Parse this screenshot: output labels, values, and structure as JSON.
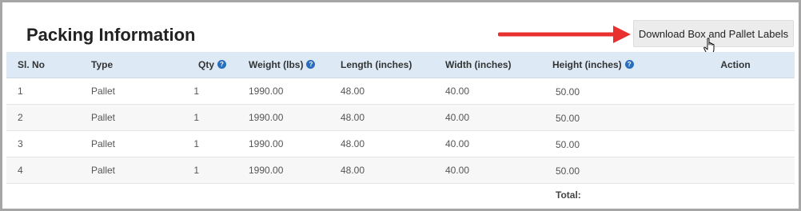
{
  "page": {
    "title": "Packing Information",
    "download_button_label": "Download Box and Pallet Labels"
  },
  "colors": {
    "arrow": "#e8312f",
    "header_bg": "#ddeaf6",
    "info_icon": "#2a6ebb"
  },
  "table": {
    "headers": {
      "sl_no": "Sl. No",
      "type": "Type",
      "qty": "Qty",
      "weight": "Weight (lbs)",
      "length": "Length (inches)",
      "width": "Width (inches)",
      "height": "Height (inches)",
      "action": "Action"
    },
    "rows": [
      {
        "sl_no": "1",
        "type": "Pallet",
        "qty": "1",
        "weight": "1990.00",
        "length": "48.00",
        "width": "40.00",
        "height": "50.00"
      },
      {
        "sl_no": "2",
        "type": "Pallet",
        "qty": "1",
        "weight": "1990.00",
        "length": "48.00",
        "width": "40.00",
        "height": "50.00"
      },
      {
        "sl_no": "3",
        "type": "Pallet",
        "qty": "1",
        "weight": "1990.00",
        "length": "48.00",
        "width": "40.00",
        "height": "50.00"
      },
      {
        "sl_no": "4",
        "type": "Pallet",
        "qty": "1",
        "weight": "1990.00",
        "length": "48.00",
        "width": "40.00",
        "height": "50.00"
      }
    ],
    "footer": {
      "total_label": "Total:"
    }
  }
}
